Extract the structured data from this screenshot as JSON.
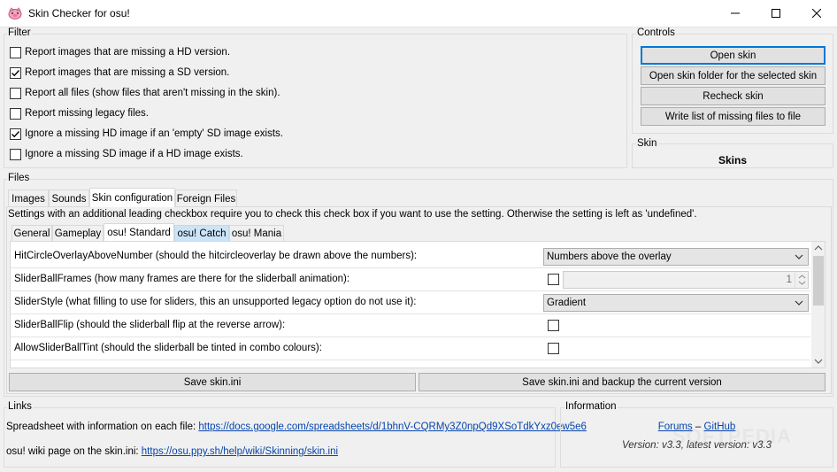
{
  "window": {
    "title": "Skin Checker for osu!",
    "icon": "osu-pig-icon"
  },
  "filter": {
    "label": "Filter",
    "options": [
      {
        "label": "Report images that are missing a HD version.",
        "checked": false
      },
      {
        "label": "Report images that are missing a SD version.",
        "checked": true
      },
      {
        "label": "Report all files (show files that aren't missing in the skin).",
        "checked": false
      },
      {
        "label": "Report missing legacy files.",
        "checked": false
      },
      {
        "label": "Ignore a missing HD image if an 'empty' SD image exists.",
        "checked": true
      },
      {
        "label": "Ignore a missing SD image if a HD image exists.",
        "checked": false
      }
    ]
  },
  "controls": {
    "label": "Controls",
    "buttons": [
      "Open skin",
      "Open skin folder for the selected skin",
      "Recheck skin",
      "Write list of missing files to file"
    ]
  },
  "skin": {
    "label": "Skin",
    "name": "Skins"
  },
  "files": {
    "label": "Files",
    "tabs": [
      "Images",
      "Sounds",
      "Skin configuration",
      "Foreign Files"
    ],
    "selected_tab": "Skin configuration",
    "info": "Settings with an additional leading checkbox require you to check this check box if you want to use the setting. Otherwise the setting is left as 'undefined'.",
    "subtabs": [
      "General",
      "Gameplay",
      "osu! Standard",
      "osu! Catch",
      "osu! Mania"
    ],
    "selected_subtab": "osu! Standard",
    "settings": [
      {
        "label": "HitCircleOverlayAboveNumber (should the hitcircleoverlay be drawn above the numbers):",
        "type": "combo",
        "value": "Numbers above the overlay"
      },
      {
        "label": "SliderBallFrames (how many frames are there for the sliderball animation):",
        "type": "checkbox-number",
        "value": "1"
      },
      {
        "label": "SliderStyle (what filling to use for sliders, this an unsupported legacy option do not use it):",
        "type": "combo",
        "value": "Gradient"
      },
      {
        "label": "SliderBallFlip (should the sliderball flip at the reverse arrow):",
        "type": "checkbox"
      },
      {
        "label": "AllowSliderBallTint (should the sliderball be tinted in combo colours):",
        "type": "checkbox"
      }
    ],
    "save_button": "Save skin.ini",
    "save_backup_button": "Save skin.ini and backup the current version"
  },
  "links": {
    "label": "Links",
    "spreadsheet_prefix": "Spreadsheet with information on each file: ",
    "spreadsheet_url": "https://docs.google.com/spreadsheets/d/1bhnV-CQRMy3Z0npQd9XSoTdkYxz0ew5e6",
    "wiki_prefix": "osu! wiki page on the skin.ini: ",
    "wiki_url": "https://osu.ppy.sh/help/wiki/Skinning/skin.ini"
  },
  "information": {
    "label": "Information",
    "forums": "Forums",
    "dash": "–",
    "github": "GitHub",
    "version": "Version: v3.3, latest version: v3.3"
  },
  "watermark": "SOFTPEDIA"
}
